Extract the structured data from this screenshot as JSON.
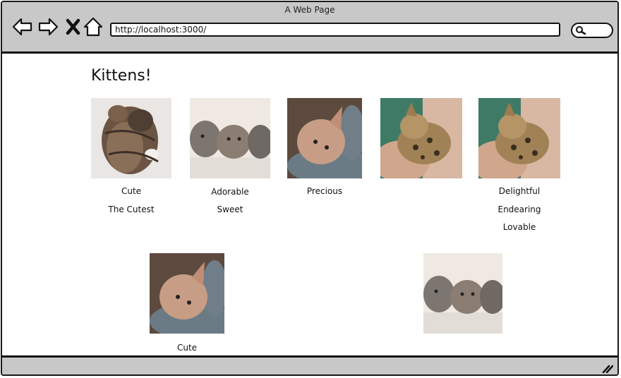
{
  "window": {
    "title": "A Web Page"
  },
  "address_bar": {
    "url": "http://localhost:3000/"
  },
  "page": {
    "heading": "Kittens!"
  },
  "gallery": [
    {
      "alt": "kittens cuddling",
      "captions": [
        "Cute",
        "The Cutest"
      ]
    },
    {
      "alt": "three kittens",
      "captions": [
        "Adorable",
        "Sweet"
      ]
    },
    {
      "alt": "kitten on blanket",
      "captions": [
        "Precious"
      ]
    },
    {
      "alt": "bengal kitten in hands",
      "captions": []
    },
    {
      "alt": "bengal kitten in hands",
      "captions": [
        "Delightful",
        "Endearing",
        "Lovable"
      ]
    },
    {
      "alt": "kitten on blanket",
      "captions": [
        "Cute"
      ]
    },
    {
      "alt": "three kittens",
      "captions": []
    }
  ]
}
